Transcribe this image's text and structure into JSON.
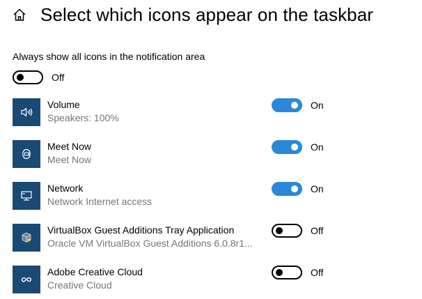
{
  "header": {
    "title": "Select which icons appear on the taskbar",
    "home_icon": "home-icon"
  },
  "always_show": {
    "label": "Always show all icons in the notification area",
    "state": "Off",
    "on": false
  },
  "colors": {
    "accent": "#2b88d8",
    "icon_tile": "#1a4a73",
    "secondary_text": "#767676"
  },
  "items": [
    {
      "name": "Volume",
      "subtitle": "Speakers: 100%",
      "state": "On",
      "on": true,
      "icon": "speaker-icon"
    },
    {
      "name": "Meet Now",
      "subtitle": "Meet Now",
      "state": "On",
      "on": true,
      "icon": "meet-now-icon"
    },
    {
      "name": "Network",
      "subtitle": "Network Internet access",
      "state": "On",
      "on": true,
      "icon": "network-icon"
    },
    {
      "name": "VirtualBox Guest Additions Tray Application",
      "subtitle": "Oracle VM VirtualBox Guest Additions 6.0.8r1...",
      "state": "Off",
      "on": false,
      "icon": "virtualbox-icon"
    },
    {
      "name": "Adobe Creative Cloud",
      "subtitle": "Creative Cloud",
      "state": "Off",
      "on": false,
      "icon": "creative-cloud-icon"
    }
  ]
}
